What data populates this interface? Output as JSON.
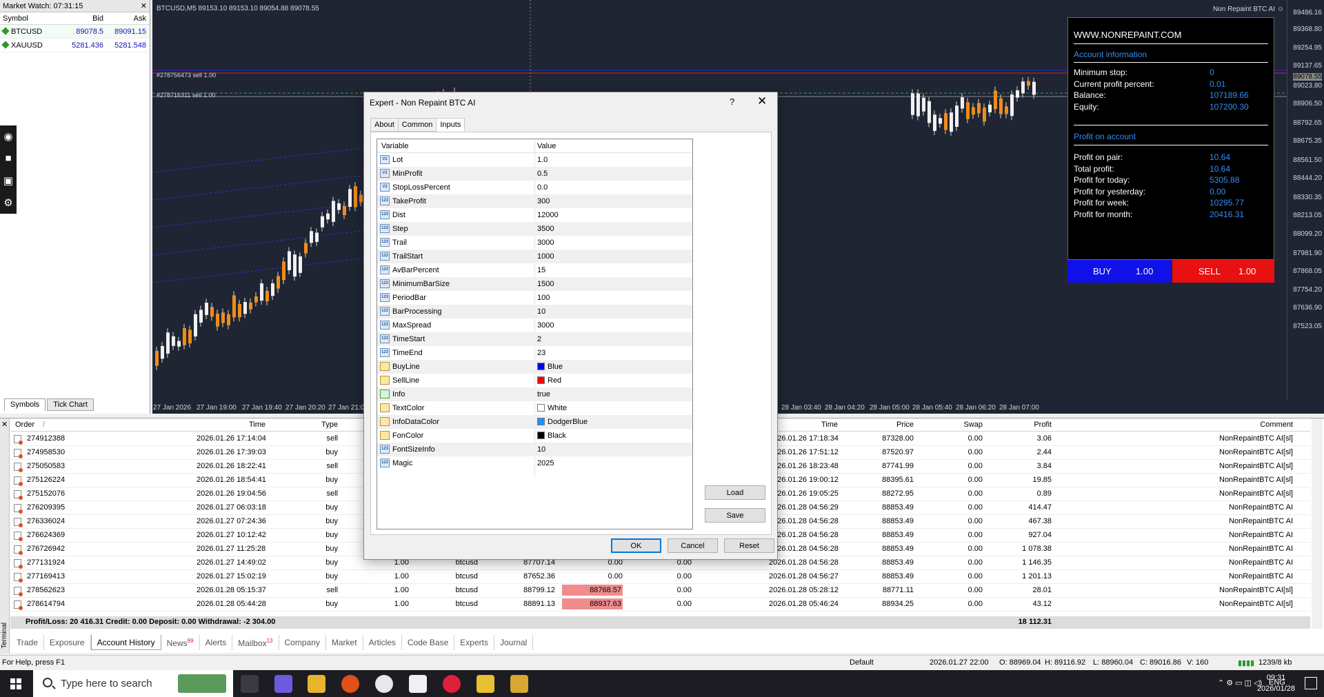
{
  "market_watch": {
    "title": "Market Watch: 07:31:15",
    "columns": [
      "Symbol",
      "Bid",
      "Ask"
    ],
    "rows": [
      {
        "symbol": "BTCUSD",
        "bid": "89078.5",
        "ask": "89091.15"
      },
      {
        "symbol": "XAUUSD",
        "bid": "5281.436",
        "ask": "5281.548"
      }
    ],
    "tabs": [
      "Symbols",
      "Tick Chart"
    ]
  },
  "chart": {
    "header": "BTCUSD,M5  89153.10 89153.10 89054.88 89078.55",
    "ea_label": "Non Repaint BTC AI ☺",
    "line_labels": [
      "#278756473 sell 1.00",
      "#278716311 sell 1.00"
    ],
    "price_ticks": [
      "89486.16",
      "89368.80",
      "89254.95",
      "89137.65",
      "89078.55",
      "89023.80",
      "88906.50",
      "88792.65",
      "88675.35",
      "88561.50",
      "88444.20",
      "88330.35",
      "88213.05",
      "88099.20",
      "87981.90",
      "87868.05",
      "87754.20",
      "87636.90",
      "87523.05"
    ],
    "current_price": "89078.55",
    "time_ticks": [
      "27 Jan 2026",
      "27 Jan 19:00",
      "27 Jan 19:40",
      "27 Jan 20:20",
      "27 Jan 21:0",
      "28 Jan 03:40",
      "28 Jan 04:20",
      "28 Jan 05:00",
      "28 Jan 05:40",
      "28 Jan 06:20",
      "28 Jan 07:00"
    ]
  },
  "info_panel": {
    "site": "WWW.NONREPAINT.COM",
    "account_section": "Account information",
    "account_rows": [
      {
        "label": "Minimum stop:",
        "value": "0"
      },
      {
        "label": "Current profit percent:",
        "value": "0.01"
      },
      {
        "label": "Balance:",
        "value": "107189.66"
      },
      {
        "label": "Equity:",
        "value": "107200.30"
      }
    ],
    "profit_section": "Profit on account",
    "profit_rows": [
      {
        "label": "Profit on pair:",
        "value": "10.64"
      },
      {
        "label": "Total profit:",
        "value": "10.64"
      },
      {
        "label": "Profit for today:",
        "value": "5305.88"
      },
      {
        "label": "Profit for yesterday:",
        "value": "0.00"
      },
      {
        "label": "Profit for week:",
        "value": "10295.77"
      },
      {
        "label": "Profit for month:",
        "value": "20416.31"
      }
    ],
    "buy_label": "BUY",
    "buy_lot": "1.00",
    "sell_label": "SELL",
    "sell_lot": "1.00"
  },
  "dialog": {
    "title": "Expert - Non Repaint BTC AI",
    "help": "?",
    "close": "✕",
    "tabs": [
      "About",
      "Common",
      "Inputs"
    ],
    "columns": [
      "Variable",
      "Value"
    ],
    "inputs": [
      {
        "name": "Lot",
        "value": "1.0",
        "type": "double"
      },
      {
        "name": "MinProfit",
        "value": "0.5",
        "type": "double"
      },
      {
        "name": "StopLossPercent",
        "value": "0.0",
        "type": "double"
      },
      {
        "name": "TakeProfit",
        "value": "300",
        "type": "int"
      },
      {
        "name": "Dist",
        "value": "12000",
        "type": "int"
      },
      {
        "name": "Step",
        "value": "3500",
        "type": "int"
      },
      {
        "name": "Trail",
        "value": "3000",
        "type": "int"
      },
      {
        "name": "TrailStart",
        "value": "1000",
        "type": "int"
      },
      {
        "name": "AvBarPercent",
        "value": "15",
        "type": "int"
      },
      {
        "name": "MinimumBarSize",
        "value": "1500",
        "type": "int"
      },
      {
        "name": "PeriodBar",
        "value": "100",
        "type": "int"
      },
      {
        "name": "BarProcessing",
        "value": "10",
        "type": "int"
      },
      {
        "name": "MaxSpread",
        "value": "3000",
        "type": "int"
      },
      {
        "name": "TimeStart",
        "value": "2",
        "type": "int"
      },
      {
        "name": "TimeEnd",
        "value": "23",
        "type": "int"
      },
      {
        "name": "BuyLine",
        "value": "Blue",
        "type": "color",
        "swatch": "#0000ff"
      },
      {
        "name": "SellLine",
        "value": "Red",
        "type": "color",
        "swatch": "#ff0000"
      },
      {
        "name": "Info",
        "value": "true",
        "type": "bool"
      },
      {
        "name": "TextColor",
        "value": "White",
        "type": "color",
        "swatch": "#ffffff"
      },
      {
        "name": "InfoDataColor",
        "value": "DodgerBlue",
        "type": "color",
        "swatch": "#1e90ff"
      },
      {
        "name": "FonColor",
        "value": "Black",
        "type": "color",
        "swatch": "#000000"
      },
      {
        "name": "FontSizeInfo",
        "value": "10",
        "type": "int"
      },
      {
        "name": "Magic",
        "value": "2025",
        "type": "int"
      }
    ],
    "load": "Load",
    "save": "Save",
    "ok": "OK",
    "cancel": "Cancel",
    "reset": "Reset"
  },
  "terminal": {
    "side_label": "Terminal",
    "columns": {
      "order": "Order",
      "sort": "/",
      "time": "Time",
      "type": "Type",
      "time2": "Time",
      "price": "Price",
      "swap": "Swap",
      "profit": "Profit",
      "comment": "Comment"
    },
    "rows": [
      {
        "order": "274912388",
        "time": "2026.01.26 17:14:04",
        "type": "sell",
        "size": "",
        "symbol": "",
        "open": "",
        "sl": "",
        "tp": "",
        "time2": "2026.01.26 17:18:34",
        "price": "87328.00",
        "swap": "0.00",
        "profit": "3.06",
        "comment": "NonRepaintBTC AI[sl]"
      },
      {
        "order": "274958530",
        "time": "2026.01.26 17:39:03",
        "type": "buy",
        "size": "",
        "symbol": "",
        "open": "",
        "sl": "",
        "tp": "",
        "time2": "2026.01.26 17:51:12",
        "price": "87520.97",
        "swap": "0.00",
        "profit": "2.44",
        "comment": "NonRepaintBTC AI[sl]"
      },
      {
        "order": "275050583",
        "time": "2026.01.26 18:22:41",
        "type": "sell",
        "size": "",
        "symbol": "",
        "open": "",
        "sl": "",
        "tp": "",
        "time2": "2026.01.26 18:23:48",
        "price": "87741.99",
        "swap": "0.00",
        "profit": "3.84",
        "comment": "NonRepaintBTC AI[sl]"
      },
      {
        "order": "275126224",
        "time": "2026.01.26 18:54:41",
        "type": "buy",
        "size": "",
        "symbol": "",
        "open": "",
        "sl": "",
        "tp": "",
        "time2": "2026.01.26 19:00:12",
        "price": "88395.61",
        "swap": "0.00",
        "profit": "19.85",
        "comment": "NonRepaintBTC AI[sl]"
      },
      {
        "order": "275152076",
        "time": "2026.01.26 19:04:56",
        "type": "sell",
        "size": "",
        "symbol": "",
        "open": "",
        "sl": "",
        "tp": "",
        "time2": "2026.01.26 19:05:25",
        "price": "88272.95",
        "swap": "0.00",
        "profit": "0.89",
        "comment": "NonRepaintBTC AI[sl]"
      },
      {
        "order": "276209395",
        "time": "2026.01.27 06:03:18",
        "type": "buy",
        "size": "",
        "symbol": "",
        "open": "",
        "sl": "",
        "tp": "",
        "time2": "2026.01.28 04:56:29",
        "price": "88853.49",
        "swap": "0.00",
        "profit": "414.47",
        "comment": "NonRepaintBTC AI"
      },
      {
        "order": "276336024",
        "time": "2026.01.27 07:24:36",
        "type": "buy",
        "size": "",
        "symbol": "",
        "open": "",
        "sl": "",
        "tp": "",
        "time2": "2026.01.28 04:56:28",
        "price": "88853.49",
        "swap": "0.00",
        "profit": "467.38",
        "comment": "NonRepaintBTC AI"
      },
      {
        "order": "276624369",
        "time": "2026.01.27 10:12:42",
        "type": "buy",
        "size": "",
        "symbol": "",
        "open": "",
        "sl": "",
        "tp": "",
        "time2": "2026.01.28 04:56:28",
        "price": "88853.49",
        "swap": "0.00",
        "profit": "927.04",
        "comment": "NonRepaintBTC AI"
      },
      {
        "order": "276726942",
        "time": "2026.01.27 11:25:28",
        "type": "buy",
        "size": "",
        "symbol": "",
        "open": "",
        "sl": "",
        "tp": "",
        "time2": "2026.01.28 04:56:28",
        "price": "88853.49",
        "swap": "0.00",
        "profit": "1 078.38",
        "comment": "NonRepaintBTC AI"
      },
      {
        "order": "277131924",
        "time": "2026.01.27 14:49:02",
        "type": "buy",
        "size": "1.00",
        "symbol": "btcusd",
        "open": "87707.14",
        "sl": "0.00",
        "tp": "0.00",
        "time2": "2026.01.28 04:56:28",
        "price": "88853.49",
        "swap": "0.00",
        "profit": "1 146.35",
        "comment": "NonRepaintBTC AI"
      },
      {
        "order": "277169413",
        "time": "2026.01.27 15:02:19",
        "type": "buy",
        "size": "1.00",
        "symbol": "btcusd",
        "open": "87652.36",
        "sl": "0.00",
        "tp": "0.00",
        "time2": "2026.01.28 04:56:27",
        "price": "88853.49",
        "swap": "0.00",
        "profit": "1 201.13",
        "comment": "NonRepaintBTC AI"
      },
      {
        "order": "278562623",
        "time": "2026.01.28 05:15:37",
        "type": "sell",
        "size": "1.00",
        "symbol": "btcusd",
        "open": "88799.12",
        "sl": "88768.57",
        "tp": "0.00",
        "time2": "2026.01.28 05:28:12",
        "price": "88771.11",
        "swap": "0.00",
        "profit": "28.01",
        "comment": "NonRepaintBTC AI[sl]"
      },
      {
        "order": "278614794",
        "time": "2026.01.28 05:44:28",
        "type": "buy",
        "size": "1.00",
        "symbol": "btcusd",
        "open": "88891.13",
        "sl": "88937.63",
        "tp": "0.00",
        "time2": "2026.01.28 05:46:24",
        "price": "88934.25",
        "swap": "0.00",
        "profit": "43.12",
        "comment": "NonRepaintBTC AI[sl]"
      }
    ],
    "pl_summary": "Profit/Loss: 20 416.31  Credit: 0.00  Deposit: 0.00  Withdrawal: -2 304.00",
    "pl_total": "18 112.31",
    "tabs": [
      {
        "label": "Trade",
        "badge": ""
      },
      {
        "label": "Exposure",
        "badge": ""
      },
      {
        "label": "Account History",
        "badge": ""
      },
      {
        "label": "News",
        "badge": "99"
      },
      {
        "label": "Alerts",
        "badge": ""
      },
      {
        "label": "Mailbox",
        "badge": "13"
      },
      {
        "label": "Company",
        "badge": ""
      },
      {
        "label": "Market",
        "badge": ""
      },
      {
        "label": "Articles",
        "badge": ""
      },
      {
        "label": "Code Base",
        "badge": ""
      },
      {
        "label": "Experts",
        "badge": ""
      },
      {
        "label": "Journal",
        "badge": ""
      }
    ]
  },
  "status_bar": {
    "help": "For Help, press F1",
    "profile": "Default",
    "datetime": "2026.01.27 22:00",
    "open": "O: 88969.04",
    "high": "H: 89116.92",
    "low": "L: 88960.04",
    "close": "C: 89016.86",
    "volume": "V: 160",
    "traffic": "1239/8 kb"
  },
  "taskbar": {
    "search_placeholder": "Type here to search",
    "language": "ENG",
    "time": "09:31",
    "date": "2026/01/28"
  }
}
